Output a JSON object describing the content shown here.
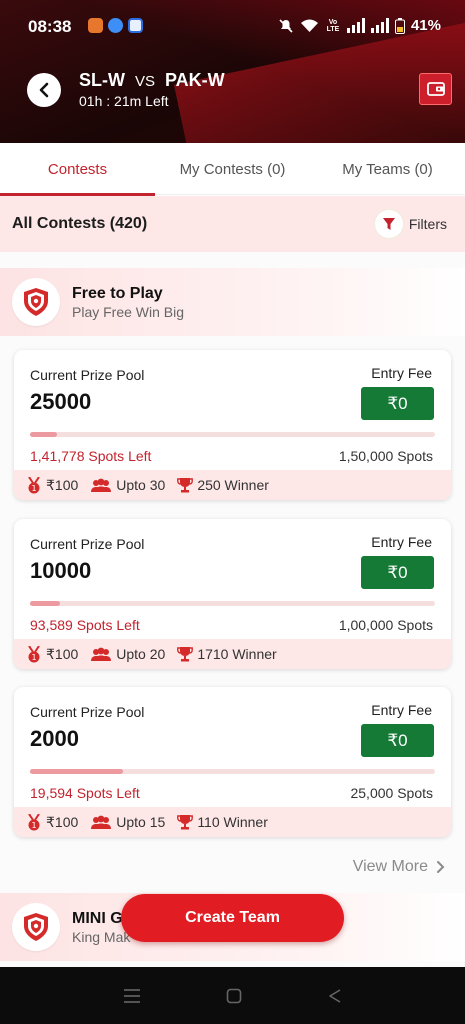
{
  "status_bar": {
    "time": "08:38",
    "battery": "41%",
    "network_label_top": "Vo",
    "network_label_bottom": "LTE"
  },
  "header": {
    "team_a": "SL-W",
    "vs": "VS",
    "team_b": "PAK-W",
    "time_left": "01h : 21m Left",
    "back_icon": "chevron-left-icon",
    "wallet_icon": "wallet-icon"
  },
  "tabs": [
    {
      "label": "Contests",
      "active": true
    },
    {
      "label": "My Contests (0)",
      "active": false
    },
    {
      "label": "My Teams (0)",
      "active": false
    }
  ],
  "all_contests": {
    "title": "All Contests (420)",
    "filters_label": "Filters"
  },
  "sections": [
    {
      "title": "Free to Play",
      "subtitle": "Play Free Win Big",
      "icon": "shield-badge-icon"
    },
    {
      "title": "MINI G",
      "subtitle": "King Mak",
      "icon": "shield-badge-icon"
    }
  ],
  "contests": [
    {
      "pool_label": "Current Prize Pool",
      "pool_value": "25000",
      "fee_label": "Entry Fee",
      "fee_value": "₹0",
      "filled_fraction": 0.067,
      "spots_left": "1,41,778 Spots Left",
      "total_spots": "1,50,000 Spots",
      "first_prize": "₹100",
      "max_entries": "Upto 30",
      "winners": "250 Winner"
    },
    {
      "pool_label": "Current Prize Pool",
      "pool_value": "10000",
      "fee_label": "Entry Fee",
      "fee_value": "₹0",
      "filled_fraction": 0.075,
      "spots_left": "93,589 Spots Left",
      "total_spots": "1,00,000 Spots",
      "first_prize": "₹100",
      "max_entries": "Upto 20",
      "winners": "1710 Winner"
    },
    {
      "pool_label": "Current Prize Pool",
      "pool_value": "2000",
      "fee_label": "Entry Fee",
      "fee_value": "₹0",
      "filled_fraction": 0.23,
      "spots_left": "19,594 Spots Left",
      "total_spots": "25,000 Spots",
      "first_prize": "₹100",
      "max_entries": "Upto 15",
      "winners": "110 Winner"
    }
  ],
  "view_more": "View More",
  "create_team": "Create Team",
  "colors": {
    "brand_red": "#c3232e",
    "button_red": "#e11d23",
    "fee_green": "#147a36",
    "pink_bg": "#fde7e7"
  }
}
